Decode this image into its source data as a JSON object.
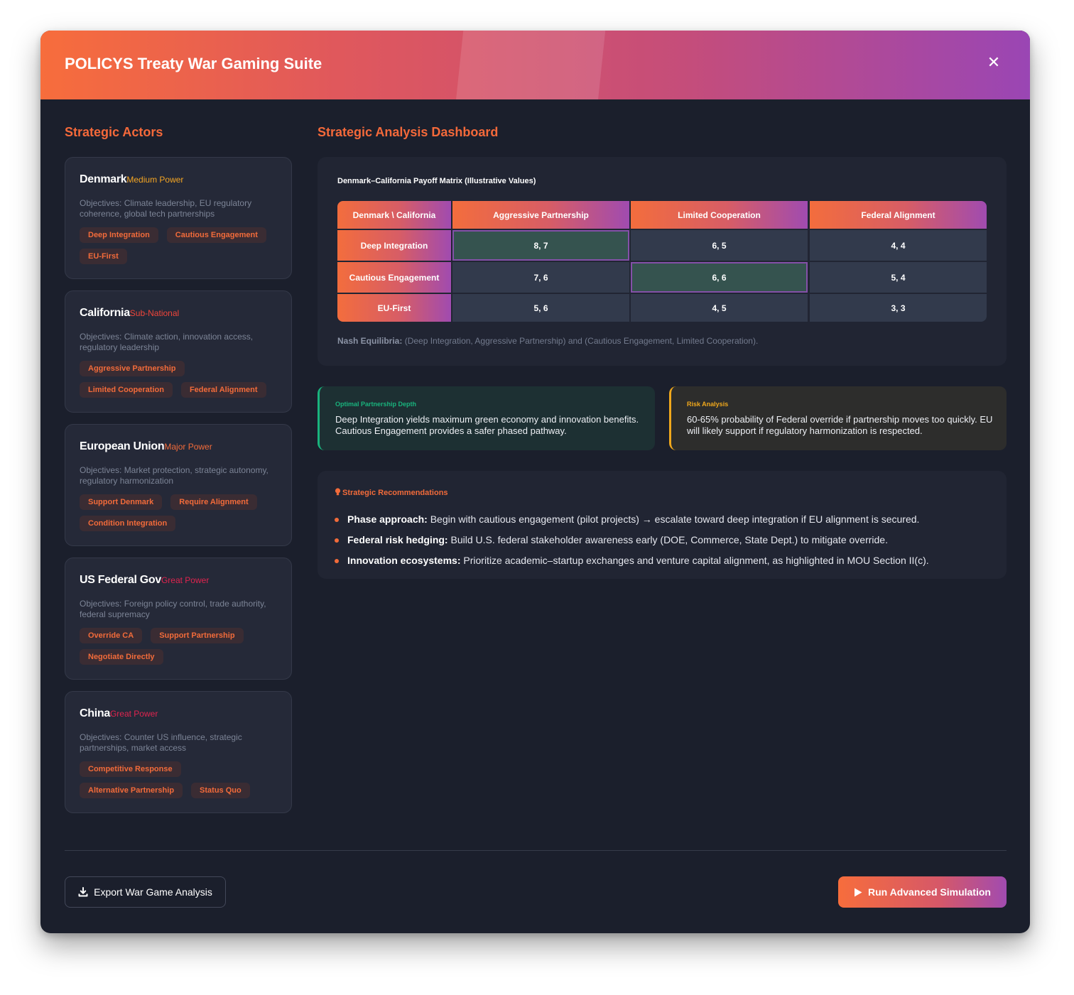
{
  "window": {
    "title": "POLICYS Treaty War Gaming Suite",
    "close_glyph": "✕"
  },
  "actors_section": {
    "title": "Strategic Actors"
  },
  "actors": [
    {
      "name": "Denmark",
      "power": "Medium Power",
      "power_color": "#f5a623",
      "objectives": "Objectives: Climate leadership, EU regulatory coherence, global tech partnerships",
      "tags": [
        "Deep Integration",
        "Cautious Engagement",
        "EU-First"
      ]
    },
    {
      "name": "California",
      "power": "Sub-National",
      "power_color": "#f0453a",
      "objectives": "Objectives: Climate action, innovation access, regulatory leadership",
      "tags": [
        "Aggressive Partnership",
        "Limited Cooperation",
        "Federal Alignment"
      ]
    },
    {
      "name": "European Union",
      "power": "Major Power",
      "power_color": "#f26b3a",
      "objectives": "Objectives: Market protection, strategic autonomy, regulatory harmonization",
      "tags": [
        "Support Denmark",
        "Require Alignment",
        "Condition Integration"
      ]
    },
    {
      "name": "US Federal Gov",
      "power": "Great Power",
      "power_color": "#e0244f",
      "objectives": "Objectives: Foreign policy control, trade authority, federal supremacy",
      "tags": [
        "Override CA",
        "Support Partnership",
        "Negotiate Directly"
      ]
    },
    {
      "name": "China",
      "power": "Great Power",
      "power_color": "#e0244f",
      "objectives": "Objectives: Counter US influence, strategic partnerships, market access",
      "tags": [
        "Competitive Response",
        "Alternative Partnership",
        "Status Quo"
      ]
    }
  ],
  "dashboard": {
    "title": "Strategic Analysis Dashboard",
    "matrix": {
      "caption": "Denmark–California Payoff Matrix (Illustrative Values)",
      "corner": "Denmark \\ California",
      "columns": [
        "Aggressive Partnership",
        "Limited Cooperation",
        "Federal Alignment"
      ],
      "rows": [
        {
          "label": "Deep Integration",
          "cells": [
            "8, 7",
            "6, 5",
            "4, 4"
          ]
        },
        {
          "label": "Cautious Engagement",
          "cells": [
            "7, 6",
            "6, 6",
            "5, 4"
          ]
        },
        {
          "label": "EU-First",
          "cells": [
            "5, 6",
            "4, 5",
            "3, 3"
          ]
        }
      ],
      "nash_label": "Nash Equilibria:",
      "nash_text": " (Deep Integration, Aggressive Partnership) and (Cautious Engagement, Limited Cooperation)."
    },
    "insights": {
      "optimal": {
        "label": "Optimal Partnership Depth",
        "color": "#19b37d",
        "text": "Deep Integration yields maximum green economy and innovation benefits. Cautious Engagement provides a safer phased pathway."
      },
      "risk": {
        "label": "Risk Analysis",
        "color": "#f0a81c",
        "text": "60-65% probability of Federal override if partnership moves too quickly. EU will likely support if regulatory harmonization is respected."
      }
    },
    "recommendations": {
      "icon": "lightbulb-icon",
      "title": "Strategic Recommendations",
      "items": [
        {
          "bold": "Phase approach:",
          "text": " Begin with cautious engagement (pilot projects) → escalate toward deep integration if EU alignment is secured."
        },
        {
          "bold": "Federal risk hedging:",
          "text": " Build U.S. federal stakeholder awareness early (DOE, Commerce, State Dept.) to mitigate override."
        },
        {
          "bold": "Innovation ecosystems:",
          "text": " Prioritize academic–startup exchanges and venture capital alignment, as highlighted in MOU Section II(c)."
        }
      ]
    }
  },
  "footer": {
    "export_label": "Export War Game Analysis",
    "export_icon": "download-icon",
    "run_label": "Run Advanced Simulation",
    "run_icon": "play-icon"
  },
  "colors": {
    "accent": "#f26b3a",
    "gradient_start": "#f76d3c",
    "gradient_end": "#9a46b4",
    "background": "#1b1f2c"
  }
}
